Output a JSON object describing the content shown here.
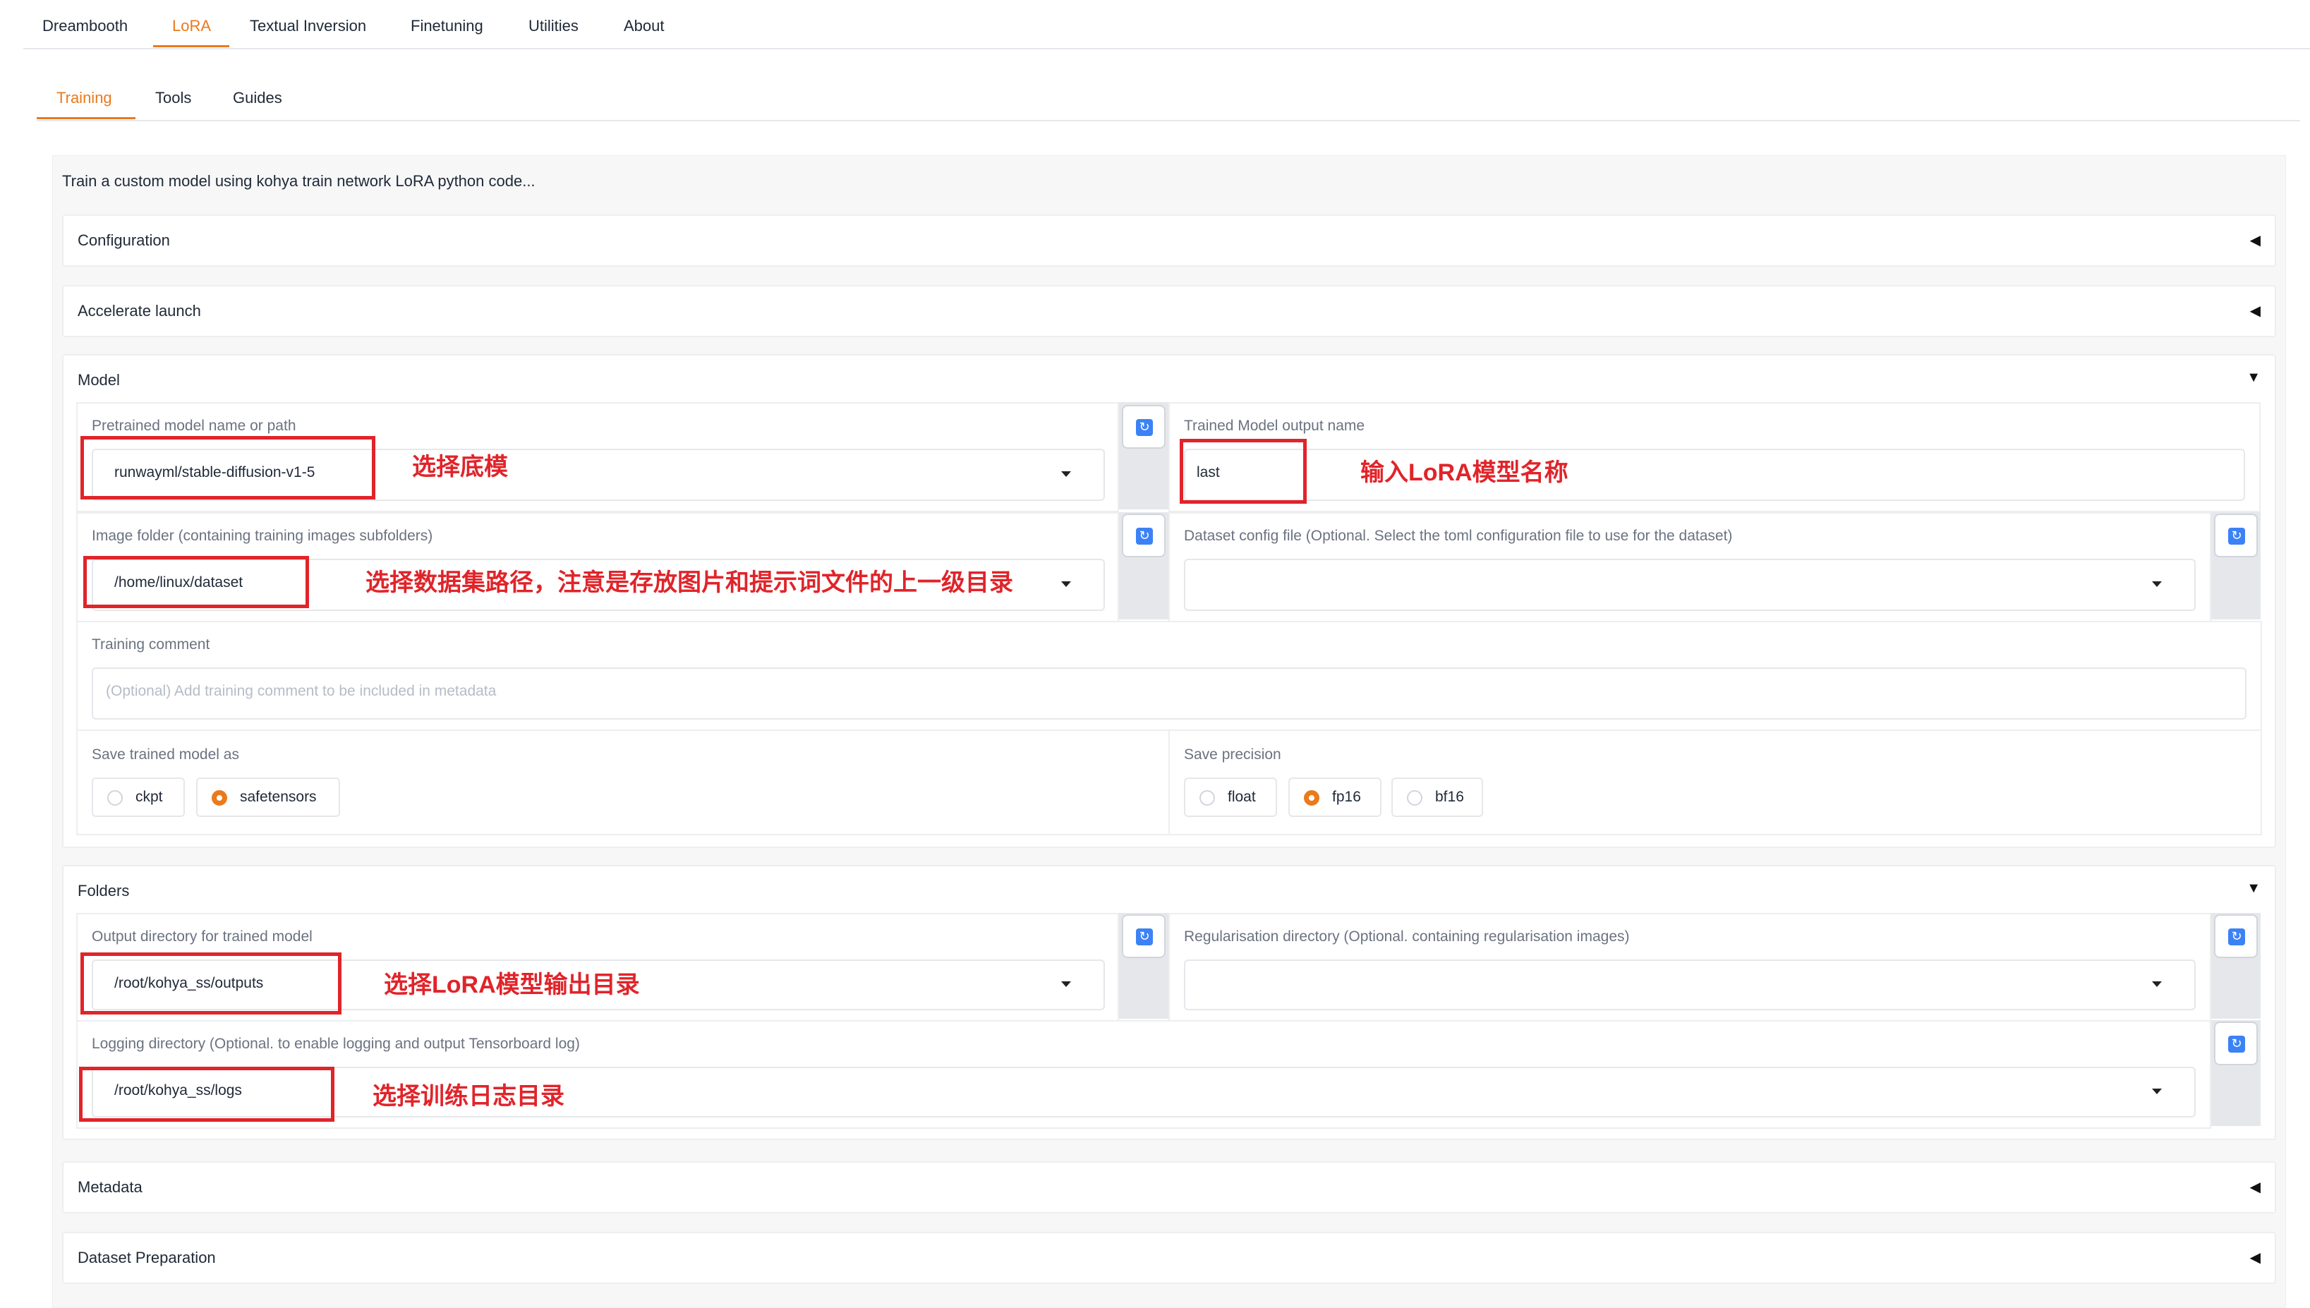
{
  "top_tabs": [
    {
      "label": "Dreambooth",
      "active": false
    },
    {
      "label": "LoRA",
      "active": true
    },
    {
      "label": "Textual Inversion",
      "active": false
    },
    {
      "label": "Finetuning",
      "active": false
    },
    {
      "label": "Utilities",
      "active": false
    },
    {
      "label": "About",
      "active": false
    }
  ],
  "sub_tabs": [
    {
      "label": "Training",
      "active": true
    },
    {
      "label": "Tools",
      "active": false
    },
    {
      "label": "Guides",
      "active": false
    }
  ],
  "description": "Train a custom model using kohya train network LoRA python code...",
  "sections": {
    "configuration": "Configuration",
    "accelerate": "Accelerate launch",
    "model": "Model",
    "folders": "Folders",
    "metadata": "Metadata",
    "dataset_preparation": "Dataset Preparation"
  },
  "carets": {
    "collapsed": "◀",
    "expanded": "▼"
  },
  "refresh_glyph": "↻",
  "model": {
    "pretrained_label": "Pretrained model name or path",
    "pretrained_value": "runwayml/stable-diffusion-v1-5",
    "output_name_label": "Trained Model output name",
    "output_name_value": "last",
    "image_folder_label": "Image folder (containing training images subfolders)",
    "image_folder_value": "/home/linux/dataset",
    "dataset_config_label": "Dataset config file (Optional. Select the toml configuration file to use for the dataset)",
    "dataset_config_value": "",
    "training_comment_label": "Training comment",
    "training_comment_placeholder": "(Optional) Add training comment to be included in metadata",
    "save_as_label": "Save trained model as",
    "save_as_options": [
      {
        "label": "ckpt",
        "checked": false
      },
      {
        "label": "safetensors",
        "checked": true
      }
    ],
    "save_precision_label": "Save precision",
    "save_precision_options": [
      {
        "label": "float",
        "checked": false
      },
      {
        "label": "fp16",
        "checked": true
      },
      {
        "label": "bf16",
        "checked": false
      }
    ]
  },
  "folders": {
    "output_dir_label": "Output directory for trained model",
    "output_dir_value": "/root/kohya_ss/outputs",
    "reg_dir_label": "Regularisation directory (Optional. containing regularisation images)",
    "reg_dir_value": "",
    "logging_dir_label": "Logging directory (Optional. to enable logging and output Tensorboard log)",
    "logging_dir_value": "/root/kohya_ss/logs"
  },
  "annotations": {
    "pretrained": "选择底模",
    "output_name": "输入LoRA模型名称",
    "image_folder": "选择数据集路径，注意是存放图片和提示词文件的上一级目录",
    "output_dir": "选择LoRA模型输出目录",
    "logging_dir": "选择训练日志目录"
  },
  "colors": {
    "accent": "#ea7a1b",
    "annotation_red": "#e0242a",
    "refresh_blue": "#3b82f6"
  }
}
